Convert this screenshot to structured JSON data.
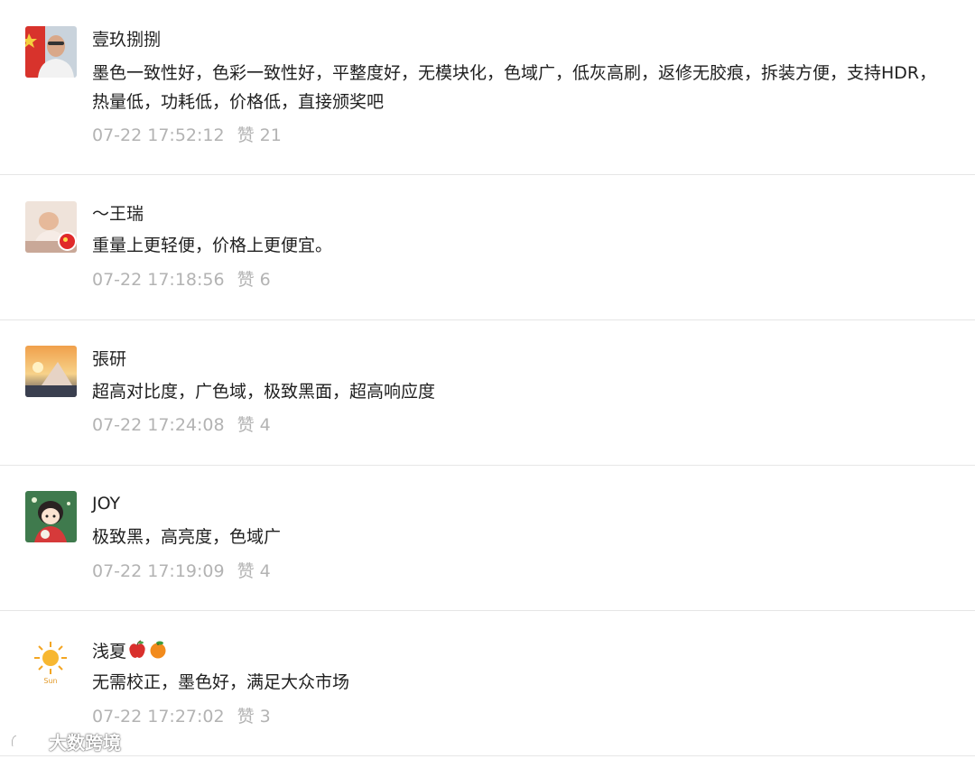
{
  "comments": [
    {
      "username": "壹玖捌捌",
      "content": "墨色一致性好，色彩一致性好，平整度好，无模块化，色域广，低灰高刷，返修无胶痕，拆装方便，支持HDR，热量低，功耗低，价格低，直接颁奖吧",
      "time": "07-22 17:52:12",
      "likes": "赞 21",
      "avatar_icon": "man-portrait-avatar-icon"
    },
    {
      "username": "～王瑞",
      "content": "重量上更轻便，价格上更便宜。",
      "time": "07-22 17:18:56",
      "likes": "赞 6",
      "avatar_icon": "baby-photo-avatar-icon"
    },
    {
      "username": "張研",
      "content": "超高对比度，广色域，极致黑面，超高响应度",
      "time": "07-22 17:24:08",
      "likes": "赞 4",
      "avatar_icon": "sunset-landscape-avatar-icon"
    },
    {
      "username": "JOY",
      "content": "极致黑，高亮度，色域广",
      "time": "07-22 17:19:09",
      "likes": "赞 4",
      "avatar_icon": "cartoon-girl-avatar-icon"
    },
    {
      "username": "浅夏",
      "username_emojis": [
        "apple-emoji",
        "tangerine-emoji"
      ],
      "content": "无需校正，墨色好，满足大众市场",
      "time": "07-22 17:27:02",
      "likes": "赞 3",
      "avatar_icon": "sun-avatar-icon",
      "avatar_text": "Sun"
    }
  ],
  "watermark": {
    "text": "大数跨境",
    "icon": "brand-logo-icon"
  },
  "colors": {
    "username": "#222222",
    "content": "#1f1f1f",
    "meta": "#b3b3b3",
    "divider": "#e6e6e6"
  }
}
